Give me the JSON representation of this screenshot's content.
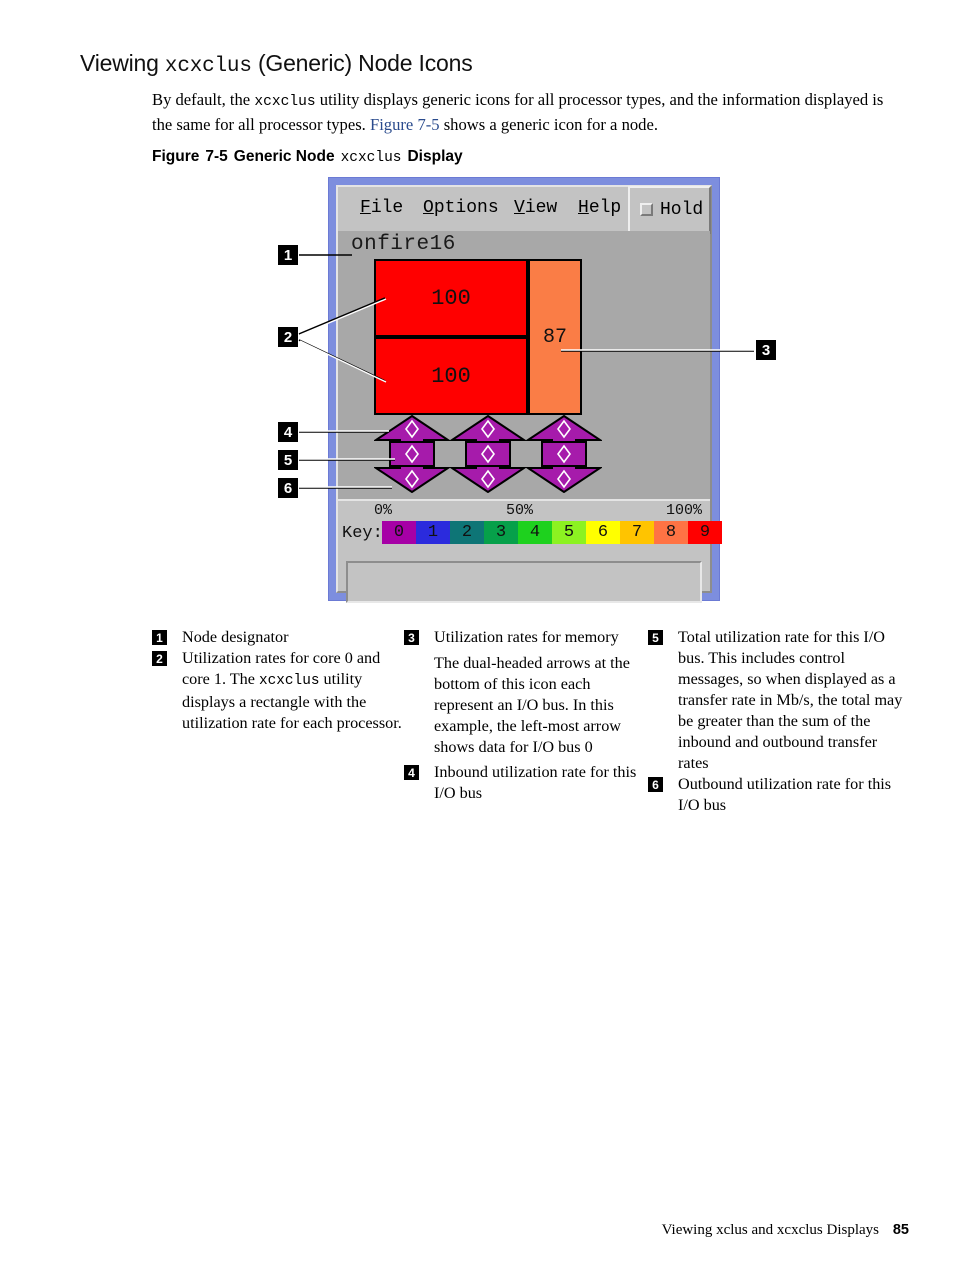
{
  "heading": {
    "pre": "Viewing ",
    "mono": "xcxclus",
    "post": " (Generic) Node Icons"
  },
  "intro": {
    "part1": "By default, the ",
    "mono1": "xcxclus",
    "part2": " utility displays generic icons for all processor types, and the information displayed is the same for all processor types. ",
    "xref": "Figure 7-5",
    "part3": " shows a generic icon for a node."
  },
  "figure_caption": {
    "label": "Figure",
    "number": "7-5",
    "title_pre": "Generic Node",
    "mono": "xcxclus",
    "title_post": "Display"
  },
  "app": {
    "menu": [
      {
        "name": "file",
        "mnemonic": "F",
        "rest": "ile"
      },
      {
        "name": "options",
        "mnemonic": "O",
        "rest": "ptions"
      },
      {
        "name": "view",
        "mnemonic": "V",
        "rest": "iew"
      },
      {
        "name": "help",
        "mnemonic": "H",
        "rest": "elp"
      }
    ],
    "hold_label": "Hold",
    "hold_checked": false,
    "node_name": "onfire16",
    "node": {
      "core0_value": "100",
      "core1_value": "100",
      "memory_value": "87",
      "core_color": "#ff0000",
      "memory_color": "#fa7d46"
    },
    "io_buses": [
      {
        "bus": "0",
        "inbound": "0",
        "total": "0",
        "outbound": "0"
      },
      {
        "bus": "1",
        "inbound": "0",
        "total": "0",
        "outbound": "0"
      },
      {
        "bus": "2",
        "inbound": "0",
        "total": "0",
        "outbound": "0"
      }
    ],
    "io_color": "#a61bab",
    "scale": {
      "min_label": "0%",
      "mid_label": "50%",
      "max_label": "100%"
    },
    "key": {
      "word": "Key:",
      "swatches": [
        {
          "label": "0",
          "color": "#a600a6"
        },
        {
          "label": "1",
          "color": "#2b2bdd"
        },
        {
          "label": "2",
          "color": "#0e7576"
        },
        {
          "label": "3",
          "color": "#06a04a"
        },
        {
          "label": "4",
          "color": "#1ed11e"
        },
        {
          "label": "5",
          "color": "#8cf221"
        },
        {
          "label": "6",
          "color": "#ffff00"
        },
        {
          "label": "7",
          "color": "#ffc400"
        },
        {
          "label": "8",
          "color": "#ff7344"
        },
        {
          "label": "9",
          "color": "#ff0000"
        }
      ]
    },
    "status_text": ""
  },
  "callouts": [
    {
      "id": "1",
      "label": "1"
    },
    {
      "id": "2",
      "label": "2"
    },
    {
      "id": "3",
      "label": "3"
    },
    {
      "id": "4",
      "label": "4"
    },
    {
      "id": "5",
      "label": "5"
    },
    {
      "id": "6",
      "label": "6"
    }
  ],
  "legend": {
    "col1": [
      {
        "num": "1",
        "text": "Node designator"
      },
      {
        "num": "2",
        "pre": "Utilization rates for core 0 and core 1. The ",
        "mono": "xcxclus",
        "post": " utility displays a rectangle with the utilization rate for each processor."
      }
    ],
    "col2": [
      {
        "num": "3",
        "text": "Utilization rates for memory",
        "cont": "The dual-headed arrows at the bottom of this icon each represent an I/O bus. In this example, the left-most arrow shows data for I/O bus 0"
      },
      {
        "num": "4",
        "text": "Inbound utilization rate for this I/O bus"
      }
    ],
    "col3": [
      {
        "num": "5",
        "text": "Total utilization rate for this I/O bus. This includes control messages, so when displayed as a transfer rate in Mb/s, the total may be greater than the sum of the inbound and outbound transfer rates"
      },
      {
        "num": "6",
        "text": "Outbound utilization rate for this I/O bus"
      }
    ]
  },
  "footer": {
    "title": "Viewing xclus and xcxclus Displays",
    "page": "85"
  }
}
